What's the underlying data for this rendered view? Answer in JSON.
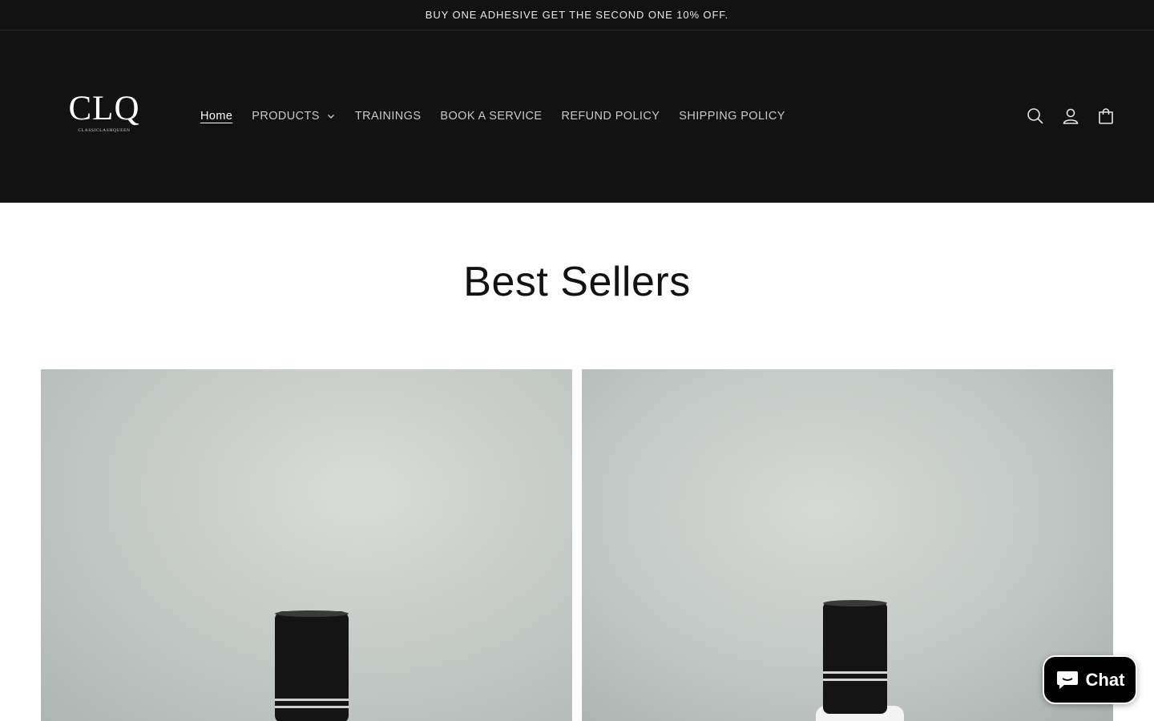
{
  "announcement": {
    "text": "BUY ONE ADHESIVE GET THE SECOND ONE 10% OFF."
  },
  "header": {
    "logo_mark": "CLQ",
    "logo_sub": "CLASSICLASHQUEEN",
    "nav": [
      {
        "label": "Home",
        "active": true
      },
      {
        "label": "PRODUCTS",
        "has_dropdown": true
      },
      {
        "label": "TRAININGS"
      },
      {
        "label": "BOOK A SERVICE"
      },
      {
        "label": "REFUND POLICY"
      },
      {
        "label": "SHIPPING POLICY"
      }
    ],
    "icons": [
      "search-icon",
      "account-icon",
      "cart-icon"
    ]
  },
  "main": {
    "section_title": "Best Sellers",
    "products": [
      {
        "image": "lash-adhesive-bottle"
      },
      {
        "image": "lash-adhesive-bottle"
      }
    ]
  },
  "chat": {
    "label": "Chat",
    "icon": "chat-bubble-icon"
  },
  "colors": {
    "header_bg": "#121212",
    "page_bg": "#ffffff",
    "text": "#121212",
    "chat_bg": "#000000"
  }
}
